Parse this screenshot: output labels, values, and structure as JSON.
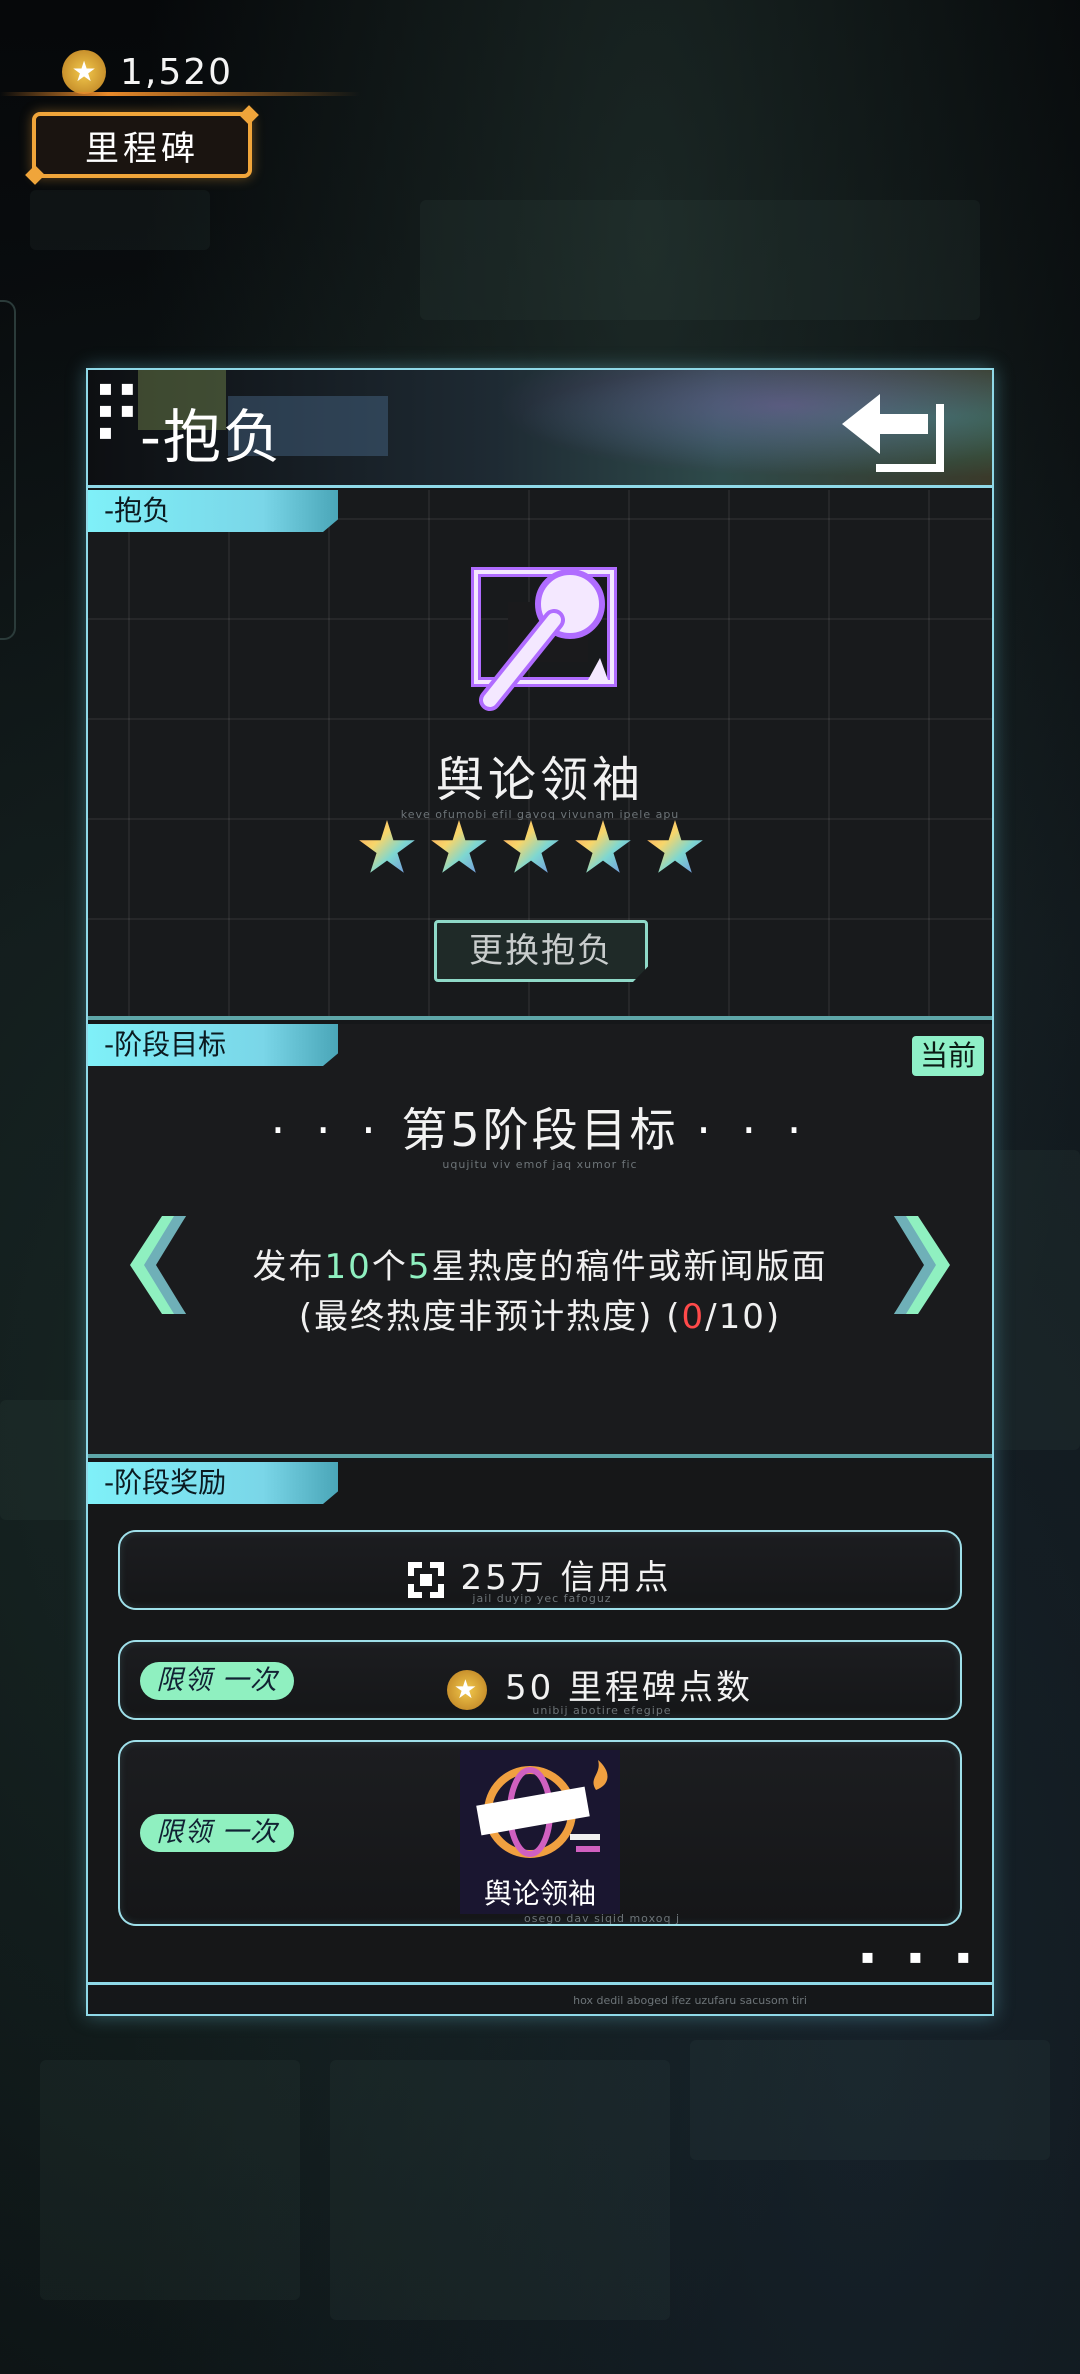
{
  "currency": {
    "icon": "star-coin-icon",
    "amount": "1,520"
  },
  "milestone_button": {
    "label": "里程碑"
  },
  "panel": {
    "title": "-抱负",
    "back_icon": "back-arrow-icon"
  },
  "ambition_section": {
    "tab_label": "-抱负",
    "icon": "microphone-icon",
    "name": "舆论领袖",
    "subtitle_tiny": "keve ofumobi efil gavoq vivunam ipele apu",
    "stars": 5,
    "change_button": "更换抱负"
  },
  "stage_section": {
    "tab_label": "-阶段目标",
    "current_badge": "当前",
    "title": "第5阶段目标",
    "title_dots_left": "· · ·",
    "title_dots_right": "· · ·",
    "subtitle_tiny": "uqujitu viv emof jaq xumor fic",
    "goal_part1": "发布",
    "goal_count": "10",
    "goal_part2": "个",
    "goal_stars": "5",
    "goal_part3": "星热度的稿件或新闻版面",
    "goal_line2_a": "(最终热度非预计热度) (",
    "goal_progress": "0",
    "goal_line2_b": "/10)",
    "prev_icon": "chevron-left-icon",
    "next_icon": "chevron-right-icon"
  },
  "reward_section": {
    "tab_label": "-阶段奖励",
    "rewards": [
      {
        "icon": "credit-icon",
        "text": "25万  信用点",
        "tiny": "jail duyip yec fafoguz"
      },
      {
        "limit": "限领 一次",
        "icon": "star-coin-icon",
        "text": "50  里程碑点数",
        "tiny": "unibij abotire efegipe"
      },
      {
        "limit": "限领 一次",
        "icon": "news-icon",
        "caption": "舆论领袖",
        "tiny": "osego dav siqid moxoq j"
      }
    ]
  },
  "footer": {
    "tiny": "hox dedil aboged ifez uzufaru sacusom tiri"
  },
  "colors": {
    "accent": "#8fd9e8",
    "green": "#8ff0c0",
    "red": "#ff4a4a",
    "orange": "#f0a53a"
  }
}
